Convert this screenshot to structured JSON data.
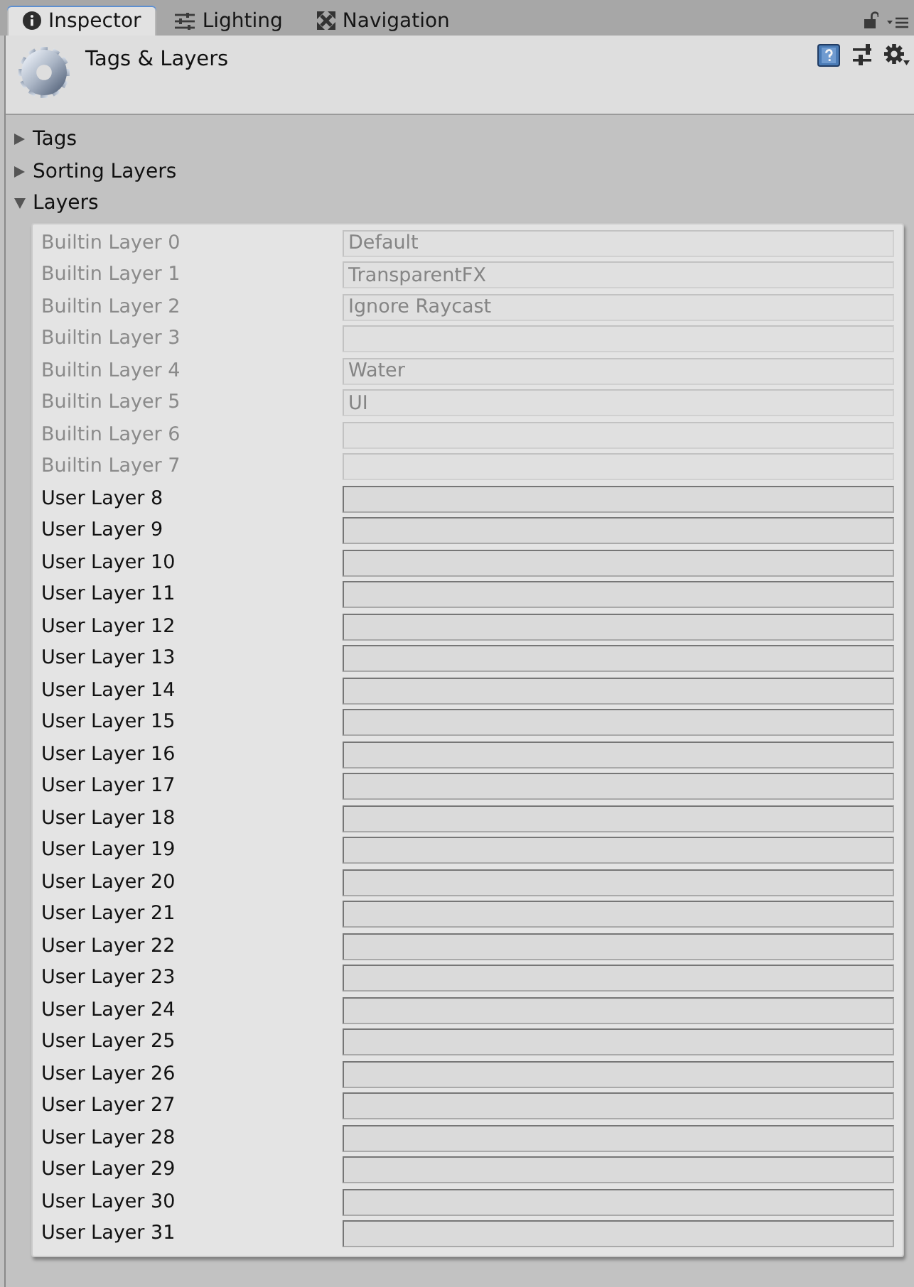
{
  "tabs": [
    {
      "label": "Inspector",
      "selected": true
    },
    {
      "label": "Lighting",
      "selected": false
    },
    {
      "label": "Navigation",
      "selected": false
    }
  ],
  "header": {
    "title": "Tags & Layers"
  },
  "sections": [
    {
      "label": "Tags",
      "expanded": false
    },
    {
      "label": "Sorting Layers",
      "expanded": false
    },
    {
      "label": "Layers",
      "expanded": true,
      "layers": [
        {
          "label": "Builtin Layer 0",
          "value": "Default",
          "disabled": true
        },
        {
          "label": "Builtin Layer 1",
          "value": "TransparentFX",
          "disabled": true
        },
        {
          "label": "Builtin Layer 2",
          "value": "Ignore Raycast",
          "disabled": true
        },
        {
          "label": "Builtin Layer 3",
          "disabled": true
        },
        {
          "label": "Builtin Layer 4",
          "value": "Water",
          "disabled": true
        },
        {
          "label": "Builtin Layer 5",
          "value": "UI",
          "disabled": true
        },
        {
          "label": "Builtin Layer 6",
          "disabled": true
        },
        {
          "label": "Builtin Layer 7",
          "disabled": true
        },
        {
          "label": "User Layer 8",
          "disabled": false
        },
        {
          "label": "User Layer 9",
          "disabled": false
        },
        {
          "label": "User Layer 10",
          "disabled": false
        },
        {
          "label": "User Layer 11",
          "disabled": false
        },
        {
          "label": "User Layer 12",
          "disabled": false
        },
        {
          "label": "User Layer 13",
          "disabled": false
        },
        {
          "label": "User Layer 14",
          "disabled": false
        },
        {
          "label": "User Layer 15",
          "disabled": false
        },
        {
          "label": "User Layer 16",
          "disabled": false
        },
        {
          "label": "User Layer 17",
          "disabled": false
        },
        {
          "label": "User Layer 18",
          "disabled": false
        },
        {
          "label": "User Layer 19",
          "disabled": false
        },
        {
          "label": "User Layer 20",
          "disabled": false
        },
        {
          "label": "User Layer 21",
          "disabled": false
        },
        {
          "label": "User Layer 22",
          "disabled": false
        },
        {
          "label": "User Layer 23",
          "disabled": false
        },
        {
          "label": "User Layer 24",
          "disabled": false
        },
        {
          "label": "User Layer 25",
          "disabled": false
        },
        {
          "label": "User Layer 26",
          "disabled": false
        },
        {
          "label": "User Layer 27",
          "disabled": false
        },
        {
          "label": "User Layer 28",
          "disabled": false
        },
        {
          "label": "User Layer 29",
          "disabled": false
        },
        {
          "label": "User Layer 30",
          "disabled": false
        },
        {
          "label": "User Layer 31",
          "disabled": false
        }
      ]
    }
  ]
}
